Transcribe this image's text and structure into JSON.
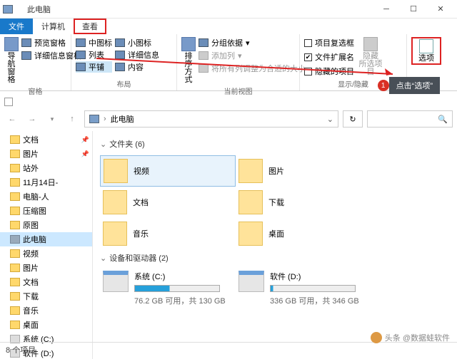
{
  "window": {
    "title": "此电脑"
  },
  "tabs": {
    "file": "文件",
    "computer": "计算机",
    "view": "查看"
  },
  "ribbon": {
    "pane_group": "窗格",
    "nav_pane": "导航窗格",
    "preview": "预览窗格",
    "details_pane": "详细信息窗格",
    "layout_group": "布局",
    "l1": "中图标",
    "l2": "小图标",
    "l3": "列表",
    "l4": "详细信息",
    "l5": "平铺",
    "l6": "内容",
    "view_group": "当前视图",
    "sort": "排序方式",
    "groupby": "分组依据",
    "addcol": "添加列",
    "fitcols": "将所有列调整为合适的大小",
    "show_group": "显示/隐藏",
    "itemchk": "项目复选框",
    "ext": "文件扩展名",
    "hidden": "隐藏的项目",
    "hidebtn": "隐藏\n所选项目",
    "options": "选项"
  },
  "address": {
    "location": "此电脑"
  },
  "tree": {
    "items": [
      {
        "label": "文档",
        "cls": "fi",
        "pin": true
      },
      {
        "label": "图片",
        "cls": "fi",
        "pin": true
      },
      {
        "label": "站外",
        "cls": "fi"
      },
      {
        "label": "11月14日-",
        "cls": "fi"
      },
      {
        "label": "电脑-人",
        "cls": "fi"
      },
      {
        "label": "压缩图",
        "cls": "fi"
      },
      {
        "label": "原图",
        "cls": "fi"
      },
      {
        "label": "此电脑",
        "cls": "pc",
        "sel": true
      },
      {
        "label": "视频",
        "cls": "fi"
      },
      {
        "label": "图片",
        "cls": "fi"
      },
      {
        "label": "文档",
        "cls": "fi"
      },
      {
        "label": "下载",
        "cls": "fi"
      },
      {
        "label": "音乐",
        "cls": "fi"
      },
      {
        "label": "桌面",
        "cls": "fi"
      },
      {
        "label": "系统 (C:)",
        "cls": "dr"
      },
      {
        "label": "软件 (D:)",
        "cls": "dr"
      }
    ]
  },
  "content": {
    "folders_header": "文件夹 (6)",
    "folders": [
      {
        "label": "视频",
        "sel": true
      },
      {
        "label": "图片"
      },
      {
        "label": "文档"
      },
      {
        "label": "下载"
      },
      {
        "label": "音乐"
      },
      {
        "label": "桌面"
      }
    ],
    "drives_header": "设备和驱动器 (2)",
    "drives": [
      {
        "label": "系统 (C:)",
        "sub": "76.2 GB 可用，共 130 GB",
        "used": "41%"
      },
      {
        "label": "软件 (D:)",
        "sub": "336 GB 可用，共 346 GB",
        "used": "3%"
      }
    ]
  },
  "status": {
    "text": "8 个项目"
  },
  "callout": {
    "num": "1",
    "text": "点击“选项”"
  },
  "watermark": {
    "text": "头条 @数据蛙软件"
  }
}
